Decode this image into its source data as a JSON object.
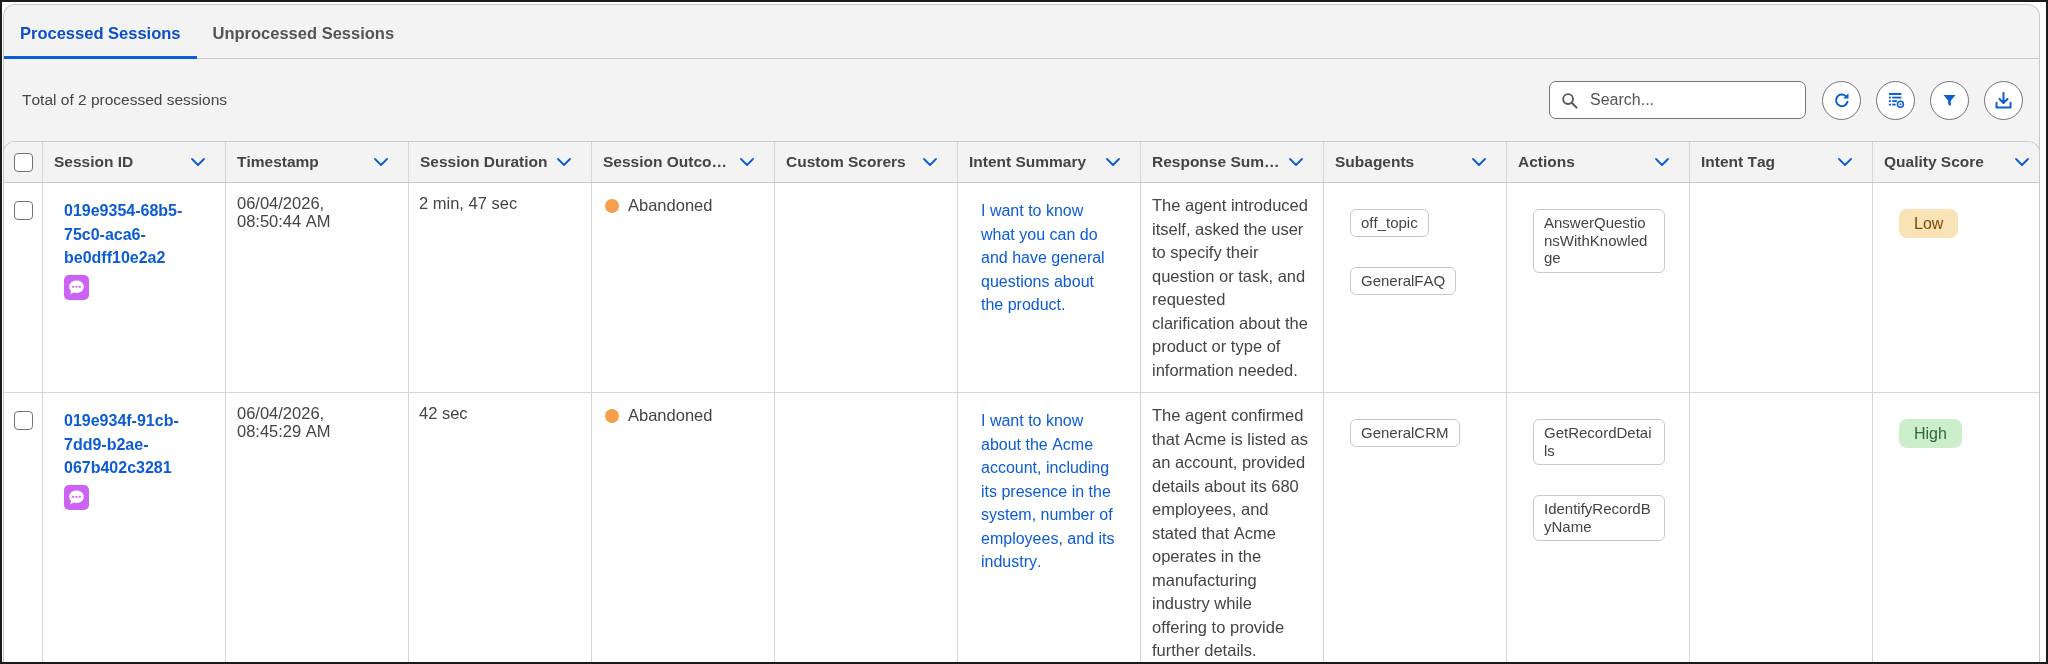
{
  "tabs": [
    {
      "label": "Processed Sessions",
      "selected": true
    },
    {
      "label": "Unprocessed Sessions",
      "selected": false
    }
  ],
  "toolbar": {
    "summary": "Total of 2 processed sessions",
    "search": {
      "placeholder": "Search..."
    },
    "buttons": [
      {
        "kind": "refresh"
      },
      {
        "kind": "table_settings"
      },
      {
        "kind": "filter"
      },
      {
        "kind": "download"
      }
    ]
  },
  "table": {
    "select_all": {
      "checked": false
    },
    "columns": [
      "Session ID",
      "Timestamp",
      "Session Duration",
      "Session Outco…",
      "Custom Scorers",
      "Intent Summary",
      "Response Sum…",
      "Subagents",
      "Actions",
      "Intent Tag",
      "Quality Score"
    ],
    "rows": [
      {
        "checked": false,
        "session_id": "019e9354-68b5-75c0-aca6-be0dff10e2a2",
        "timestamp": "06/04/2026, 08:50:44 AM",
        "duration": "2 min, 47 sec",
        "outcome": {
          "label": "Abandoned",
          "color": "#f59e4b"
        },
        "intent_summary": "I want to know what you can do and have general questions about the product.",
        "response_summary": "The agent introduced itself, asked the user to specify their question or task, and requested clarification about the product or type of information needed.",
        "subagents": [
          "off_topic",
          "GeneralFAQ"
        ],
        "actions": [
          "AnswerQuestionsWithKnowledge"
        ],
        "quality_score": {
          "label": "Low",
          "kind": "low"
        }
      },
      {
        "checked": false,
        "session_id": "019e934f-91cb-7dd9-b2ae-067b402c3281",
        "timestamp": "06/04/2026, 08:45:29 AM",
        "duration": "42 sec",
        "outcome": {
          "label": "Abandoned",
          "color": "#f59e4b"
        },
        "intent_summary": "I want to know about the Acme account, including its presence in the system, number of employees, and its industry.",
        "response_summary": "The agent confirmed that Acme is listed as an account, provided details about its 680 employees, and stated that Acme operates in the manufacturing industry while offering to provide further details.",
        "subagents": [
          "GeneralCRM"
        ],
        "actions": [
          "GetRecordDetails",
          "IdentifyRecordByName"
        ],
        "quality_score": {
          "label": "High",
          "kind": "high"
        }
      }
    ]
  }
}
